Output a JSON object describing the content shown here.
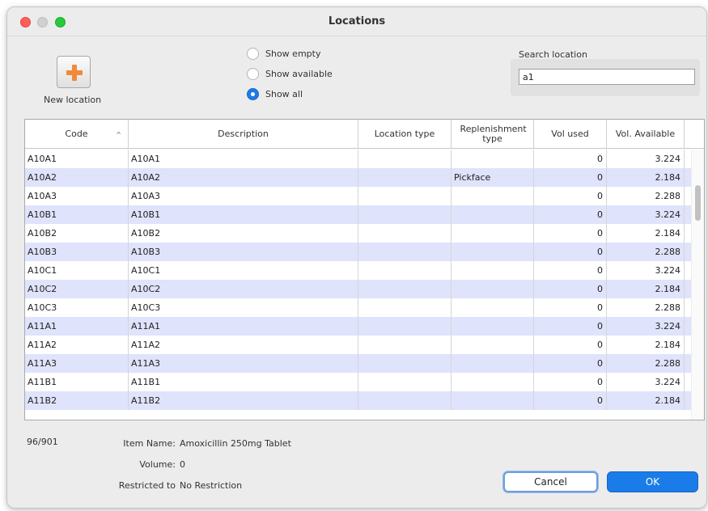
{
  "window": {
    "title": "Locations"
  },
  "toolbar": {
    "new_location_label": "New location"
  },
  "filters": {
    "options": [
      {
        "label": "Show empty",
        "checked": false
      },
      {
        "label": "Show available",
        "checked": false
      },
      {
        "label": "Show all",
        "checked": true
      }
    ]
  },
  "search": {
    "label": "Search location",
    "value": "a1"
  },
  "table": {
    "columns": [
      "Code",
      "Description",
      "Location type",
      "Replenishment type",
      "Vol used",
      "Vol. Available"
    ],
    "rows": [
      {
        "code": "A10A1",
        "description": "A10A1",
        "location_type": "",
        "replenishment_type": "",
        "vol_used": "0",
        "vol_available": "3.224"
      },
      {
        "code": "A10A2",
        "description": "A10A2",
        "location_type": "",
        "replenishment_type": "Pickface",
        "vol_used": "0",
        "vol_available": "2.184"
      },
      {
        "code": "A10A3",
        "description": "A10A3",
        "location_type": "",
        "replenishment_type": "",
        "vol_used": "0",
        "vol_available": "2.288"
      },
      {
        "code": "A10B1",
        "description": "A10B1",
        "location_type": "",
        "replenishment_type": "",
        "vol_used": "0",
        "vol_available": "3.224"
      },
      {
        "code": "A10B2",
        "description": "A10B2",
        "location_type": "",
        "replenishment_type": "",
        "vol_used": "0",
        "vol_available": "2.184"
      },
      {
        "code": "A10B3",
        "description": "A10B3",
        "location_type": "",
        "replenishment_type": "",
        "vol_used": "0",
        "vol_available": "2.288"
      },
      {
        "code": "A10C1",
        "description": "A10C1",
        "location_type": "",
        "replenishment_type": "",
        "vol_used": "0",
        "vol_available": "3.224"
      },
      {
        "code": "A10C2",
        "description": "A10C2",
        "location_type": "",
        "replenishment_type": "",
        "vol_used": "0",
        "vol_available": "2.184"
      },
      {
        "code": "A10C3",
        "description": "A10C3",
        "location_type": "",
        "replenishment_type": "",
        "vol_used": "0",
        "vol_available": "2.288"
      },
      {
        "code": "A11A1",
        "description": "A11A1",
        "location_type": "",
        "replenishment_type": "",
        "vol_used": "0",
        "vol_available": "3.224"
      },
      {
        "code": "A11A2",
        "description": "A11A2",
        "location_type": "",
        "replenishment_type": "",
        "vol_used": "0",
        "vol_available": "2.184"
      },
      {
        "code": "A11A3",
        "description": "A11A3",
        "location_type": "",
        "replenishment_type": "",
        "vol_used": "0",
        "vol_available": "2.288"
      },
      {
        "code": "A11B1",
        "description": "A11B1",
        "location_type": "",
        "replenishment_type": "",
        "vol_used": "0",
        "vol_available": "3.224"
      },
      {
        "code": "A11B2",
        "description": "A11B2",
        "location_type": "",
        "replenishment_type": "",
        "vol_used": "0",
        "vol_available": "2.184"
      }
    ]
  },
  "footer": {
    "count": "96/901",
    "item_name_label": "Item Name:",
    "item_name_value": "Amoxicillin 250mg Tablet",
    "volume_label": "Volume:",
    "volume_value": "0",
    "restricted_label": "Restricted to",
    "restricted_value": "No Restriction"
  },
  "buttons": {
    "cancel": "Cancel",
    "ok": "OK"
  },
  "colors": {
    "accent": "#1a7ce8",
    "row_alt": "#dfe3fb",
    "plus_icon": "#f08a3c"
  }
}
